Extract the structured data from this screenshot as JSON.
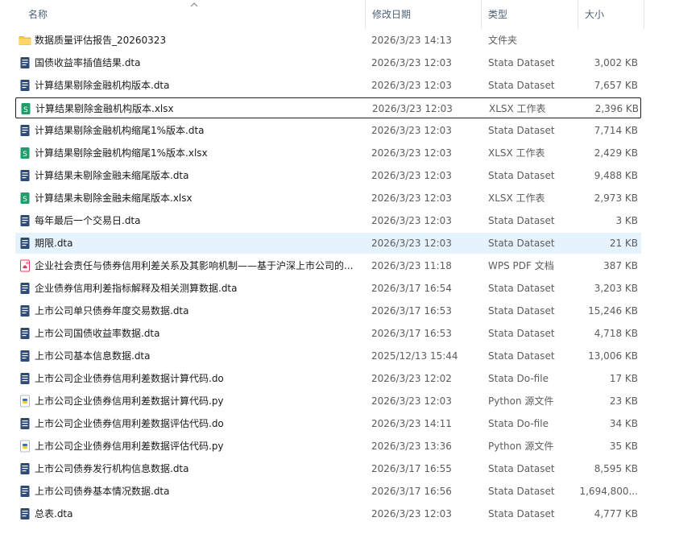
{
  "columns": {
    "name": "名称",
    "date": "修改日期",
    "type": "类型",
    "size": "大小"
  },
  "colors": {
    "folder": "#f7c948",
    "dta": "#2d4a7a",
    "xlsx": "#1f9d6b",
    "pdf": "#e03a5a",
    "py": "#3b6fb0",
    "selected": "#e5f3ff"
  },
  "files": [
    {
      "name": "数据质量评估报告_20260323",
      "date": "2026/3/23 14:13",
      "type": "文件夹",
      "size": "",
      "icon": "folder-icon"
    },
    {
      "name": "国债收益率插值结果.dta",
      "date": "2026/3/23 12:03",
      "type": "Stata Dataset",
      "size": "3,002 KB",
      "icon": "dta-file-icon"
    },
    {
      "name": "计算结果剔除金融机构版本.dta",
      "date": "2026/3/23 12:03",
      "type": "Stata Dataset",
      "size": "7,657 KB",
      "icon": "dta-file-icon"
    },
    {
      "name": "计算结果剔除金融机构版本.xlsx",
      "date": "2026/3/23 12:03",
      "type": "XLSX 工作表",
      "size": "2,396 KB",
      "icon": "xlsx-file-icon",
      "focused": true
    },
    {
      "name": "计算结果剔除金融机构缩尾1%版本.dta",
      "date": "2026/3/23 12:03",
      "type": "Stata Dataset",
      "size": "7,714 KB",
      "icon": "dta-file-icon"
    },
    {
      "name": "计算结果剔除金融机构缩尾1%版本.xlsx",
      "date": "2026/3/23 12:03",
      "type": "XLSX 工作表",
      "size": "2,429 KB",
      "icon": "xlsx-file-icon"
    },
    {
      "name": "计算结果未剔除金融未缩尾版本.dta",
      "date": "2026/3/23 12:03",
      "type": "Stata Dataset",
      "size": "9,488 KB",
      "icon": "dta-file-icon"
    },
    {
      "name": "计算结果未剔除金融未缩尾版本.xlsx",
      "date": "2026/3/23 12:03",
      "type": "XLSX 工作表",
      "size": "2,973 KB",
      "icon": "xlsx-file-icon"
    },
    {
      "name": "每年最后一个交易日.dta",
      "date": "2026/3/23 12:03",
      "type": "Stata Dataset",
      "size": "3 KB",
      "icon": "dta-file-icon"
    },
    {
      "name": "期限.dta",
      "date": "2026/3/23 12:03",
      "type": "Stata Dataset",
      "size": "21 KB",
      "icon": "dta-file-icon",
      "selected": true
    },
    {
      "name": "企业社会责任与债券信用利差关系及其影响机制——基于沪深上市公司的...",
      "date": "2026/3/23 11:18",
      "type": "WPS PDF 文档",
      "size": "387 KB",
      "icon": "pdf-file-icon"
    },
    {
      "name": "企业债券信用利差指标解释及相关测算数据.dta",
      "date": "2026/3/17 16:54",
      "type": "Stata Dataset",
      "size": "3,203 KB",
      "icon": "dta-file-icon"
    },
    {
      "name": "上市公司单只债券年度交易数据.dta",
      "date": "2026/3/17 16:53",
      "type": "Stata Dataset",
      "size": "15,246 KB",
      "icon": "dta-file-icon"
    },
    {
      "name": "上市公司国债收益率数据.dta",
      "date": "2026/3/17 16:53",
      "type": "Stata Dataset",
      "size": "4,718 KB",
      "icon": "dta-file-icon"
    },
    {
      "name": "上市公司基本信息数据.dta",
      "date": "2025/12/13 15:44",
      "type": "Stata Dataset",
      "size": "13,006 KB",
      "icon": "dta-file-icon"
    },
    {
      "name": "上市公司企业债券信用利差数据计算代码.do",
      "date": "2026/3/23 12:02",
      "type": "Stata Do-file",
      "size": "17 KB",
      "icon": "do-file-icon"
    },
    {
      "name": "上市公司企业债券信用利差数据计算代码.py",
      "date": "2026/3/23 12:03",
      "type": "Python 源文件",
      "size": "23 KB",
      "icon": "py-file-icon"
    },
    {
      "name": "上市公司企业债券信用利差数据评估代码.do",
      "date": "2026/3/23 14:11",
      "type": "Stata Do-file",
      "size": "34 KB",
      "icon": "do-file-icon"
    },
    {
      "name": "上市公司企业债券信用利差数据评估代码.py",
      "date": "2026/3/23 13:36",
      "type": "Python 源文件",
      "size": "35 KB",
      "icon": "py-file-icon"
    },
    {
      "name": "上市公司债券发行机构信息数据.dta",
      "date": "2026/3/17 16:55",
      "type": "Stata Dataset",
      "size": "8,595 KB",
      "icon": "dta-file-icon"
    },
    {
      "name": "上市公司债券基本情况数据.dta",
      "date": "2026/3/17 16:56",
      "type": "Stata Dataset",
      "size": "1,694,800...",
      "icon": "dta-file-icon"
    },
    {
      "name": "总表.dta",
      "date": "2026/3/23 12:03",
      "type": "Stata Dataset",
      "size": "4,777 KB",
      "icon": "dta-file-icon"
    }
  ]
}
